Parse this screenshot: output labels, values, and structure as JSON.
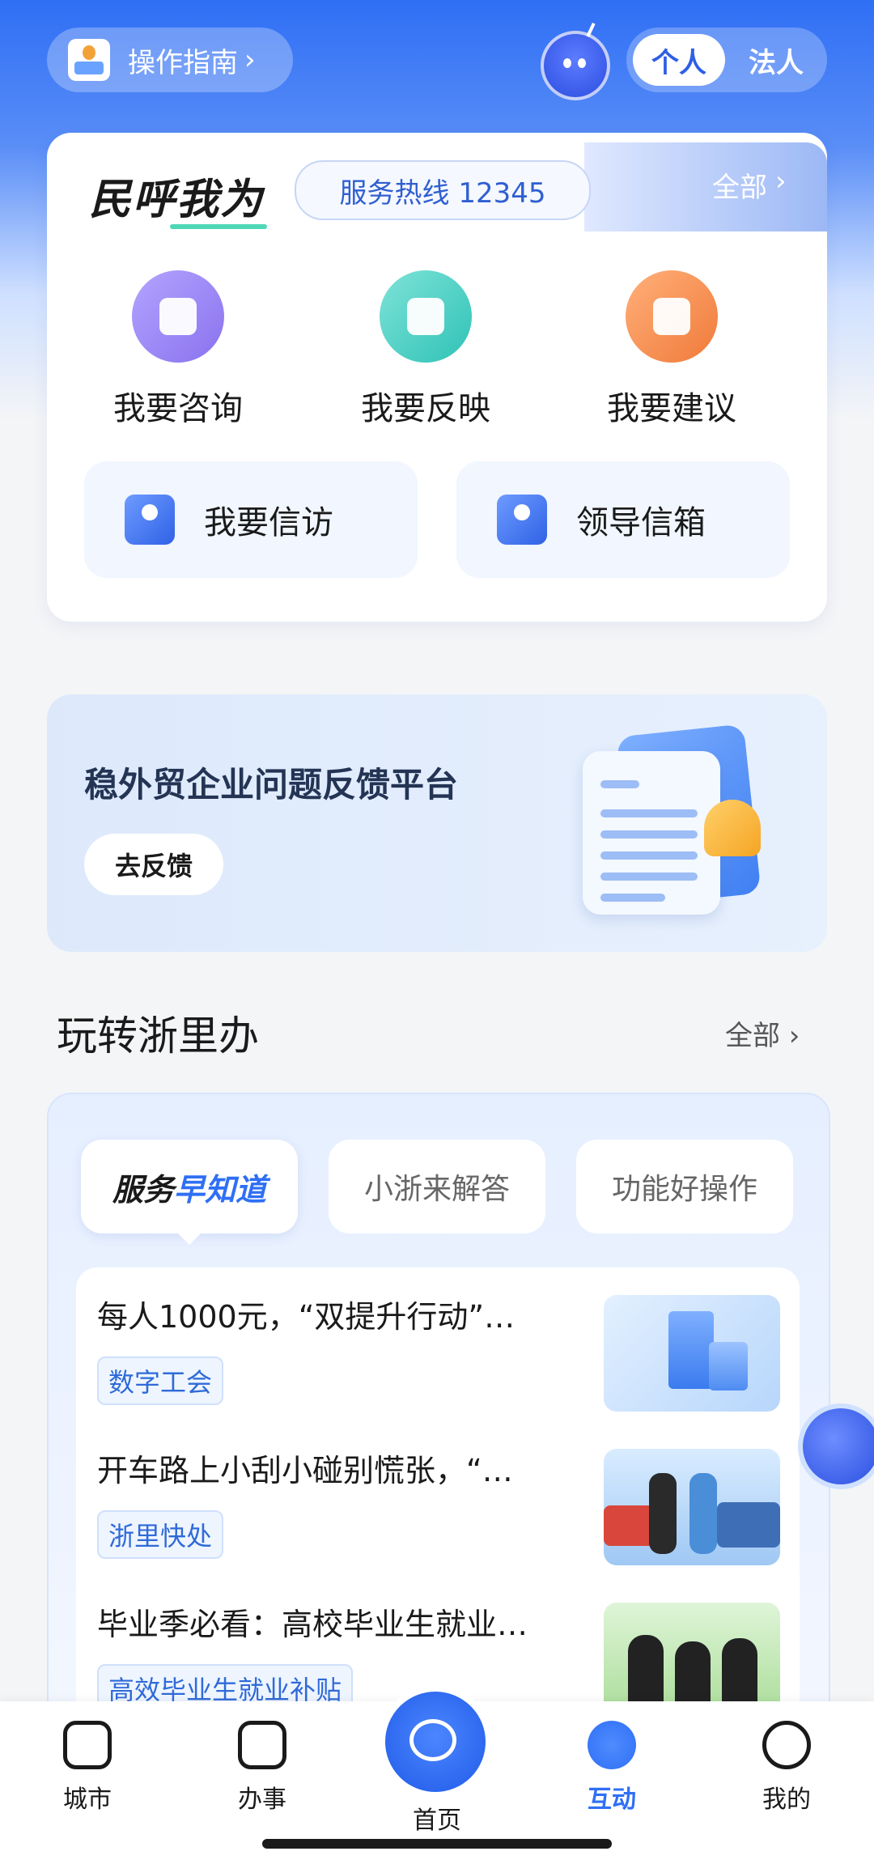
{
  "top": {
    "guide_label": "操作指南",
    "guide_chevron": "›",
    "seg_personal": "个人",
    "seg_corp": "法人"
  },
  "card1": {
    "title": "民呼我为",
    "hotline": "服务热线 12345",
    "all_label": "全部",
    "services": [
      {
        "label": "我要咨询",
        "color": "#8f7df2"
      },
      {
        "label": "我要反映",
        "color": "#3fd0c6"
      },
      {
        "label": "我要建议",
        "color": "#f48b4a"
      }
    ],
    "buttons": [
      {
        "label": "我要信访"
      },
      {
        "label": "领导信箱"
      }
    ]
  },
  "banner": {
    "title": "稳外贸企业问题反馈平台",
    "button": "去反馈"
  },
  "section": {
    "title": "玩转浙里办",
    "all_label": "全部 ›",
    "tabs": [
      {
        "label_a": "服务",
        "label_b": "早知道"
      },
      {
        "label": "小浙来解答"
      },
      {
        "label": "功能好操作"
      }
    ],
    "items": [
      {
        "title": "每人1000元，“双提升行动”…",
        "tag": "数字工会"
      },
      {
        "title": "开车路上小刮小碰别慌张，“…",
        "tag": "浙里快处"
      },
      {
        "title": "毕业季必看：高校毕业生就业…",
        "tag": "高效毕业生就业补贴"
      }
    ]
  },
  "tabbar": {
    "items": [
      {
        "label": "城市"
      },
      {
        "label": "办事"
      },
      {
        "label": "首页"
      },
      {
        "label": "互动"
      },
      {
        "label": "我的"
      }
    ],
    "active": "互动"
  }
}
